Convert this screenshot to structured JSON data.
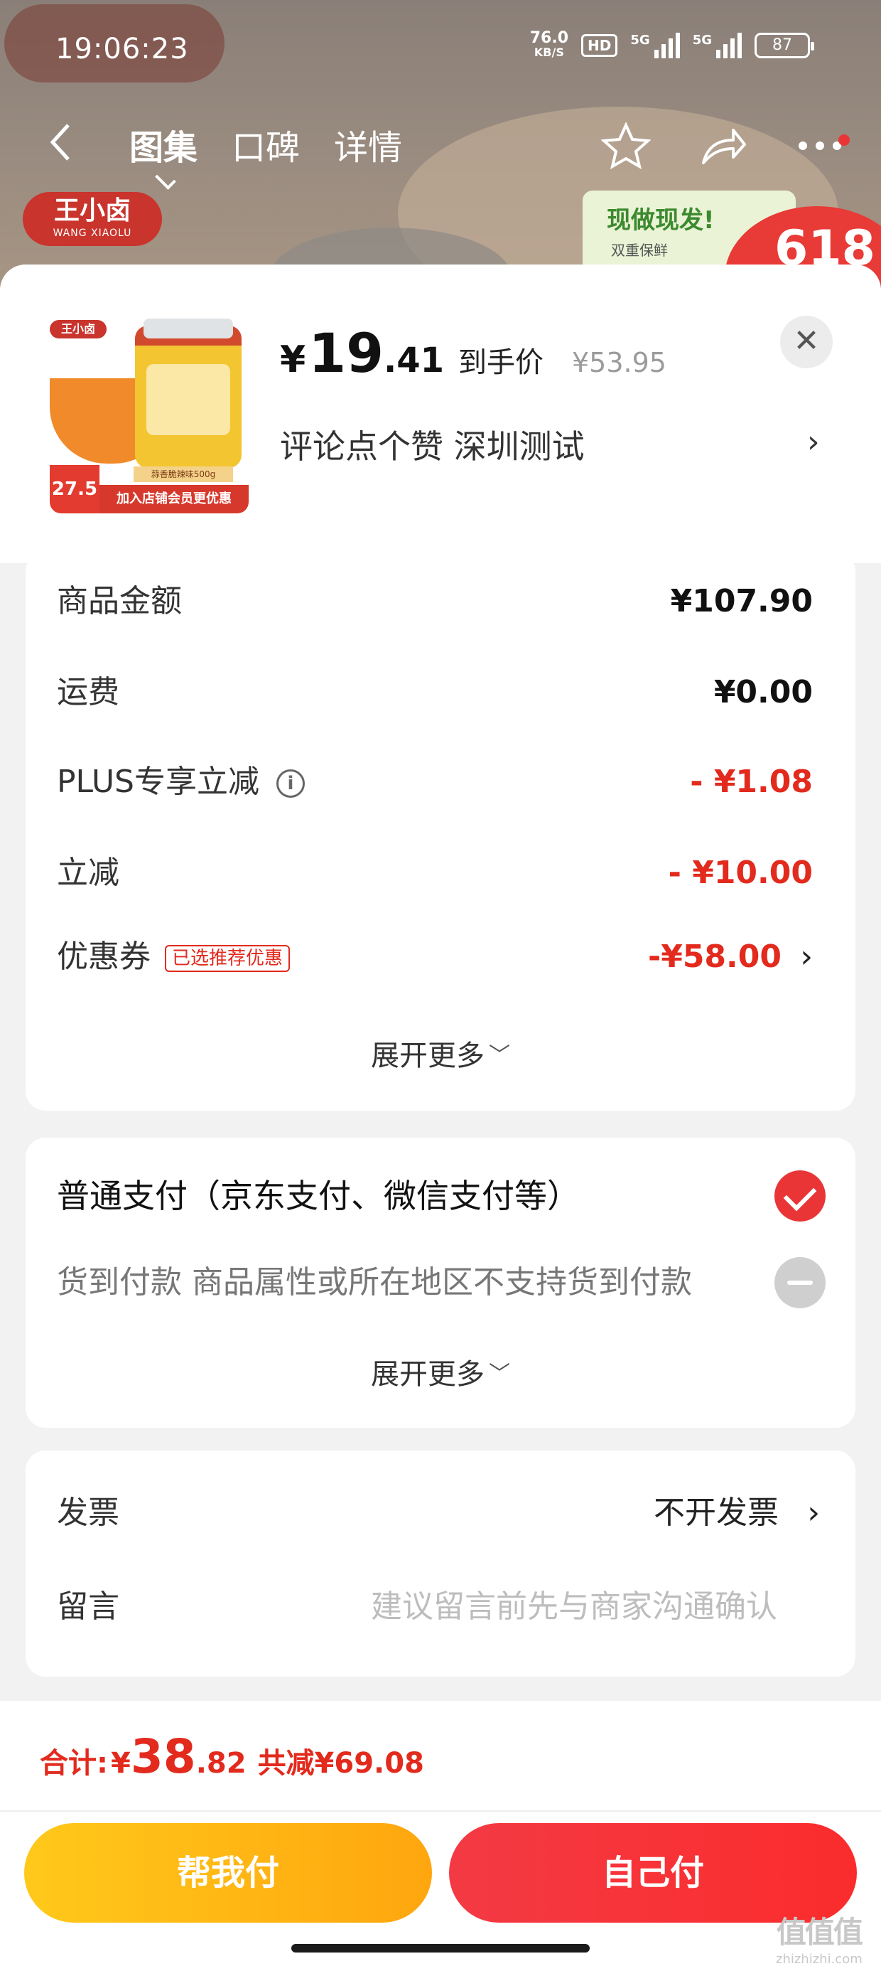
{
  "status_bar": {
    "time": "19:06:23",
    "net_speed_value": "76.0",
    "net_speed_unit": "KB/S",
    "hd_label": "HD",
    "signal1_label": "5G",
    "signal2_label": "5G",
    "battery": "87"
  },
  "background_page": {
    "tabs": [
      {
        "label": "图集",
        "active": true
      },
      {
        "label": "口碑",
        "active": false
      },
      {
        "label": "详情",
        "active": false
      }
    ],
    "brand_cn": "王小卤",
    "brand_en": "WANG XIAOLU",
    "promo_title": "现做现发!",
    "promo_sub": "双重保鲜",
    "promo_badge": "618"
  },
  "product": {
    "thumb_brand": "王小卤",
    "thumb_badge": "27.5",
    "thumb_strip": "加入店铺会员更优惠",
    "thumb_strip_small": "蒜香脆辣味500g",
    "price_currency": "¥",
    "price_integer": "19",
    "price_decimal": ".41",
    "price_tag": "到手价",
    "original_price": "¥53.95",
    "spec_text": "评论点个赞  深圳测试",
    "close_glyph": "✕"
  },
  "amounts": {
    "rows": [
      {
        "label": "商品金额",
        "value": "¥107.90"
      },
      {
        "label": "运费",
        "value": "¥0.00"
      },
      {
        "label": "PLUS专享立减",
        "value": "- ¥1.08"
      },
      {
        "label": "立减",
        "value": "- ¥10.00"
      },
      {
        "label": "优惠券",
        "tag": "已选推荐优惠",
        "value": "-¥58.00"
      }
    ],
    "expand_label": "展开更多"
  },
  "payment": {
    "options": [
      {
        "label": "普通支付（京东支付、微信支付等）",
        "selected": true
      },
      {
        "label": "货到付款 商品属性或所在地区不支持货到付款",
        "selected": false
      }
    ],
    "expand_label": "展开更多"
  },
  "extras": {
    "invoice_label": "发票",
    "invoice_value": "不开发票",
    "message_label": "留言",
    "message_placeholder": "建议留言前先与商家沟通确认"
  },
  "bottom_bar": {
    "total_label": "合计:",
    "total_currency": "¥",
    "total_integer": "38",
    "total_decimal": ".82",
    "total_save": "共减¥69.08",
    "help_pay_label": "帮我付",
    "self_pay_label": "自己付"
  },
  "watermark": {
    "big": "值值值",
    "small": "zhizhizhi.com"
  },
  "colors": {
    "accent_red": "#e22a1d",
    "button_yellow": "#ffb812",
    "button_red": "#f5333d"
  }
}
